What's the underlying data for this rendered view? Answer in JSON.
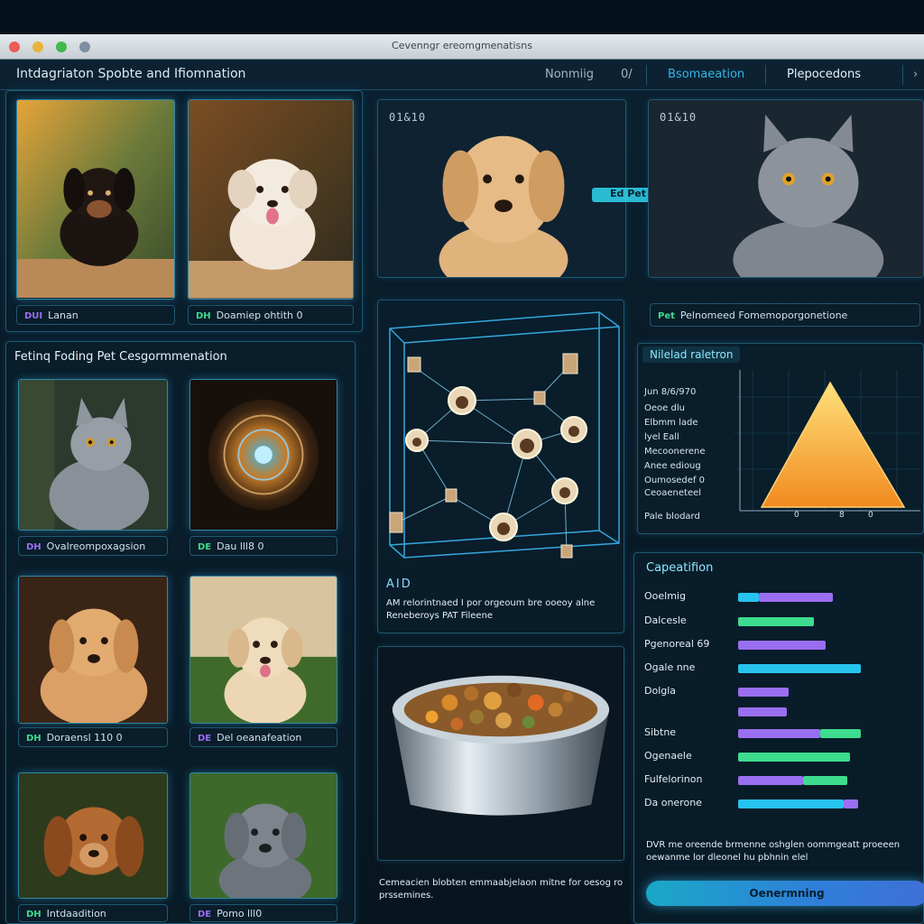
{
  "window": {
    "title": "Cevenngr ereomgmenatisns"
  },
  "toolbar": {
    "app_title": "Intdagriaton Spobte and Ifiomnation",
    "items": [
      "Nonmiig",
      "0/",
      "Bsomaeation",
      "Plepocedons"
    ]
  },
  "left_top": {
    "captions": [
      {
        "badge": "DUI",
        "text": "Lanan"
      },
      {
        "badge": "DH",
        "text": "Doamiep ohtith 0"
      }
    ]
  },
  "left_bottom": {
    "title": "Fetinq Foding Pet Cesgormmenation",
    "captions": [
      {
        "badge": "DH",
        "text": "Ovalreompoxagsion"
      },
      {
        "badge": "DE",
        "text": "Dau lll8 0"
      },
      {
        "badge": "DH",
        "text": "Doraensl 110 0"
      },
      {
        "badge": "DE",
        "text": "Del oeanafeation"
      },
      {
        "badge": "DH",
        "text": "Intdaadition"
      },
      {
        "badge": "DE",
        "text": "Pomo lll0"
      }
    ]
  },
  "compare": {
    "stamp_a": "01&10",
    "stamp_b": "01&10",
    "arrow_label": "Ed Pet",
    "result_badge": "Pet",
    "result_text": "Pelnomeed Fomemoporgonetione"
  },
  "network": {
    "label": "AID",
    "description": "AM relorintnaed I por orgeoum bre ooeoy alne Reneberoys PAT Fileene"
  },
  "food": {
    "description": "Cemeacien blobten emmaabjelaon mitne for oesog ro prssemines."
  },
  "related": {
    "title": "Nilelad raletron",
    "labels": [
      "Jun 8/6/970",
      "Oeoe dlu",
      "Elbmm lade",
      "lyel Eall",
      "Mecoonerene",
      "Anee edioug",
      "Oumosedef 0",
      "Ceoaeneteel",
      "Pale blodard"
    ],
    "ticks": [
      "0",
      "8",
      "0"
    ]
  },
  "capabilities": {
    "title": "Capeatifion",
    "colors": {
      "blue": "#27c3ef",
      "purple": "#9a6ef0",
      "green": "#3ddc8e"
    },
    "metrics": [
      {
        "label": "Ooelmig",
        "segments": [
          {
            "color": "blue",
            "value": 0.11
          },
          {
            "color": "purple",
            "value": 0.4
          }
        ]
      },
      {
        "label": "Dalcesle",
        "segments": [
          {
            "color": "green",
            "value": 0.41
          }
        ]
      },
      {
        "label": "Pgenoreal 69",
        "segments": [
          {
            "color": "purple",
            "value": 0.47
          }
        ]
      },
      {
        "label": "Ogale nne",
        "segments": [
          {
            "color": "blue",
            "value": 0.66
          }
        ]
      },
      {
        "label": "Dolgla",
        "segments": [
          {
            "color": "purple",
            "value": 0.27
          }
        ]
      },
      {
        "label": "",
        "segments": [
          {
            "color": "purple",
            "value": 0.26
          }
        ]
      },
      {
        "label": "Sibtne",
        "segments": [
          {
            "color": "purple",
            "value": 0.44
          },
          {
            "color": "green",
            "value": 0.22
          }
        ]
      },
      {
        "label": "Ogenaele",
        "segments": [
          {
            "color": "green",
            "value": 0.6
          }
        ]
      },
      {
        "label": "Fulfelorinon",
        "segments": [
          {
            "color": "purple",
            "value": 0.35
          },
          {
            "color": "green",
            "value": 0.24
          }
        ]
      },
      {
        "label": "Da onerone",
        "segments": [
          {
            "color": "blue",
            "value": 0.57
          },
          {
            "color": "purple",
            "value": 0.08
          }
        ]
      }
    ],
    "note": "DVR me oreende brmenne oshglen oommgeatt proeeen oewanme lor dleonel hu pbhnin elel",
    "button_label": "Oenermning"
  }
}
